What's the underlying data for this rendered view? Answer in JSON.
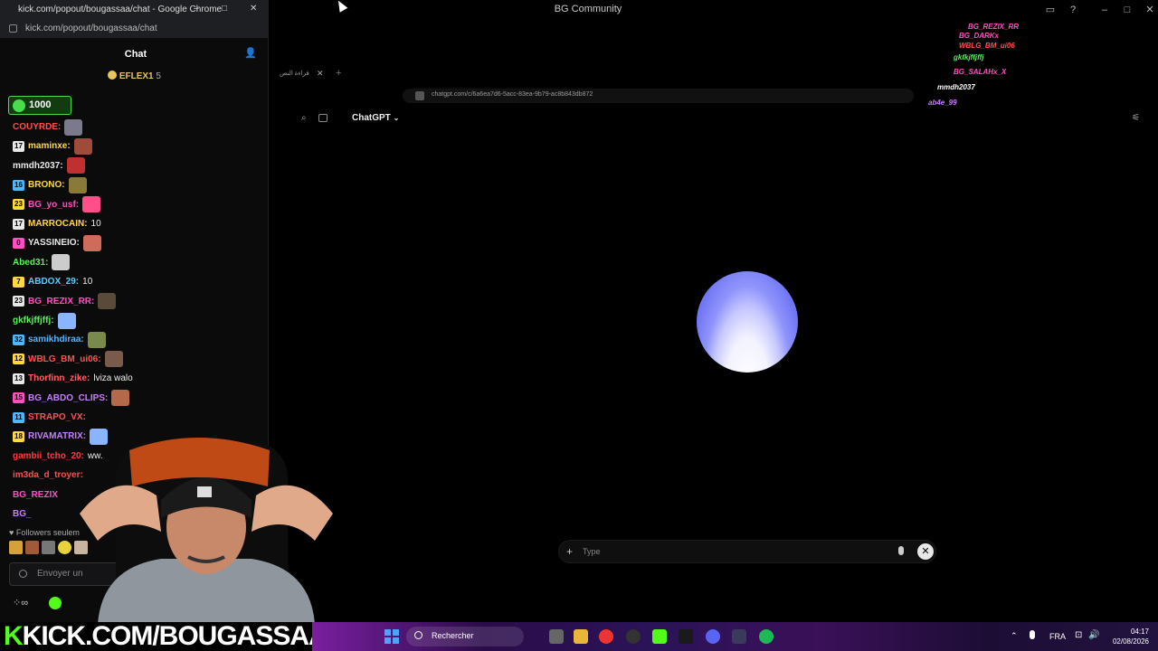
{
  "main_window": {
    "title": "BG Community"
  },
  "chat_window": {
    "title": "kick.com/popout/bougassaa/chat - Google Chrome",
    "url": "kick.com/popout/bougassaa/chat",
    "header": "Chat",
    "pinned": "EFLEX1",
    "pinned_count": "5",
    "points": "1000",
    "messages": [
      {
        "user": "COUYRDE:",
        "text": "",
        "color": "#ff4d4d",
        "badge": ""
      },
      {
        "user": "maminxe:",
        "text": "",
        "color": "#ffd93d",
        "badge": "17"
      },
      {
        "user": "mmdh2037:",
        "text": "",
        "color": "#e8e8e8",
        "badge": ""
      },
      {
        "user": "BRONO:",
        "text": "",
        "color": "#ffd93d",
        "badge": "16"
      },
      {
        "user": "BG_yo_usf:",
        "text": "",
        "color": "#ff4fc1",
        "badge": "23"
      },
      {
        "user": "MARROCAIN:",
        "text": "10",
        "color": "#ffd93d",
        "badge": "17"
      },
      {
        "user": "YASSINEIO:",
        "text": "",
        "color": "#e8e8e8",
        "badge": "0"
      },
      {
        "user": "Abed31:",
        "text": "",
        "color": "#5cf05c",
        "badge": ""
      },
      {
        "user": "ABDOX_29:",
        "text": "10",
        "color": "#4dd2ff",
        "badge": "7"
      },
      {
        "user": "BG_REZIX_RR:",
        "text": "",
        "color": "#ff4fc1",
        "badge": "23"
      },
      {
        "user": "gkfkjffjffj:",
        "text": "",
        "color": "#5cf05c",
        "badge": ""
      },
      {
        "user": "samikhdiraa:",
        "text": "",
        "color": "#4db8ff",
        "badge": "32"
      },
      {
        "user": "WBLG_BM_ui06:",
        "text": "",
        "color": "#ff5050",
        "badge": "12"
      },
      {
        "user": "Thorfinn_zike:",
        "text": "lviza walo",
        "color": "#ff6060",
        "badge": "13"
      },
      {
        "user": "BG_ABDO_CLIPS:",
        "text": "",
        "color": "#c77dff",
        "badge": "15"
      },
      {
        "user": "STRAPO_VX:",
        "text": "",
        "color": "#ff5050",
        "badge": "11"
      },
      {
        "user": "RIVAMATRIX:",
        "text": "",
        "color": "#c77dff",
        "badge": "18"
      },
      {
        "user": "gambii_tcho_20:",
        "text": "ww.",
        "color": "#ff3b3b",
        "badge": ""
      },
      {
        "user": "im3da_d_troyer:",
        "text": "",
        "color": "#ff4d4d",
        "badge": ""
      },
      {
        "user": "BG_REZIX",
        "text": "",
        "color": "#ff4fc1",
        "badge": ""
      },
      {
        "user": "BG_",
        "text": "",
        "color": "#c77dff",
        "badge": ""
      }
    ],
    "followers_text": "Followers seulem",
    "input_placeholder": "Envoyer un"
  },
  "banner": {
    "k": "K",
    "text": "KICK.COM/BOUGASSAA"
  },
  "browser": {
    "tab_title": "قراءة النص",
    "url": "chatgpt.com/c/6a6ea7d6-5acc-83ea-9b79-ac8b843db872",
    "app_title": "ChatGPT",
    "composer_placeholder": "Type"
  },
  "overlay_chat": [
    {
      "user": "mmdh2037",
      "color": "#ffffff"
    },
    {
      "user": "ab4e_99",
      "color": "#c77dff"
    },
    {
      "user": "BG_SALAHx_X",
      "color": "#ff4fc1"
    },
    {
      "user": "gkfkjffjffj",
      "color": "#5cf05c"
    },
    {
      "user": "WBLG_BM_ui06",
      "color": "#ff5050"
    },
    {
      "user": "BG_DARKx",
      "color": "#ff4fc1"
    },
    {
      "user": "BG_REZIX_RR",
      "color": "#ff4fc1"
    }
  ],
  "taskbar": {
    "search": "Rechercher",
    "lang": "FRA",
    "time": "04:17",
    "date": "02/08/2026"
  }
}
